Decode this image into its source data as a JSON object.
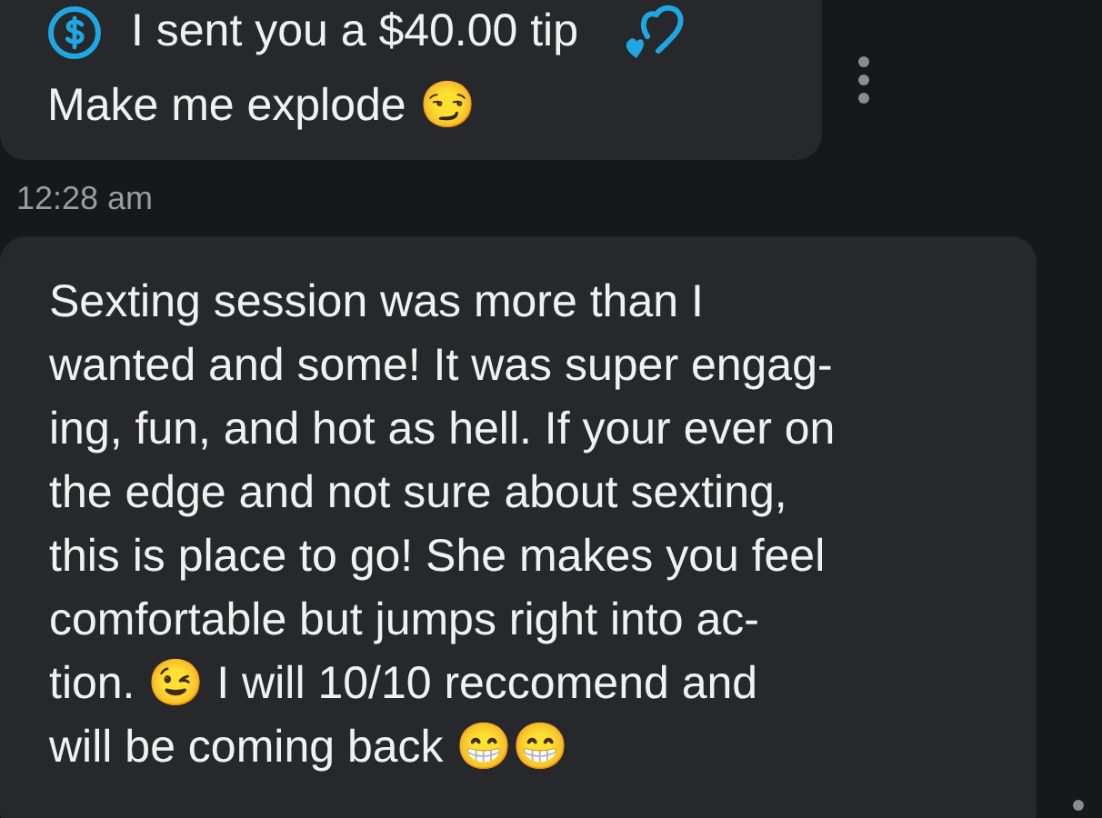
{
  "messages": [
    {
      "kind": "tip",
      "tip_text": "I sent you a $40.00 tip",
      "text": "Make me explode 😏",
      "time": "12:28 am"
    },
    {
      "kind": "text",
      "text": "Sexting session was more than I\nwanted and some! It was super engag-\ning, fun, and hot as hell. If your ever on\nthe edge and not sure about sexting,\nthis is place to go! She makes you feel\ncomfortable but jumps right into ac-\ntion. 😉 I will 10/10 reccomend and\nwill be coming back 😁😁"
    }
  ]
}
